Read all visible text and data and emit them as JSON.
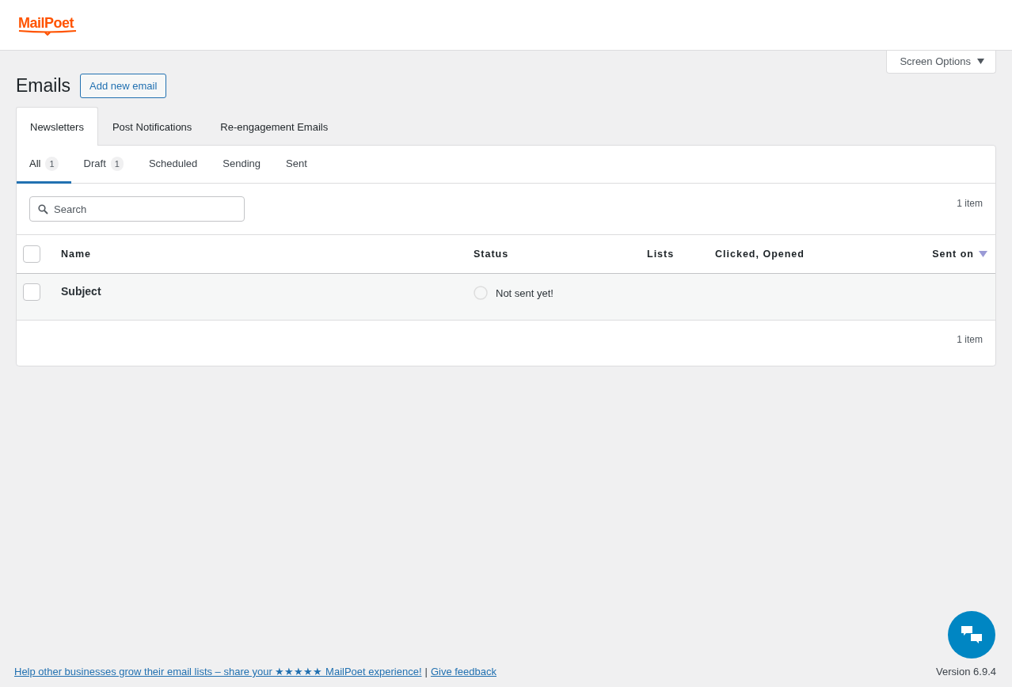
{
  "header": {
    "logo": "MailPoet"
  },
  "screen_options": {
    "label": "Screen Options",
    "expanded": false
  },
  "page": {
    "title": "Emails",
    "add_button": "Add new email"
  },
  "tabs": [
    {
      "label": "Newsletters",
      "selected": true
    },
    {
      "label": "Post Notifications",
      "selected": false
    },
    {
      "label": "Re-engagement Emails",
      "selected": false
    }
  ],
  "filters": [
    {
      "label": "All",
      "count": "1",
      "selected": true
    },
    {
      "label": "Draft",
      "count": "1",
      "selected": false
    },
    {
      "label": "Scheduled",
      "selected": false
    },
    {
      "label": "Sending",
      "selected": false
    },
    {
      "label": "Sent",
      "selected": false
    }
  ],
  "search": {
    "placeholder": "Search"
  },
  "item_count_top": "1 item",
  "table": {
    "columns": [
      {
        "label": "Name"
      },
      {
        "label": "Status"
      },
      {
        "label": "Lists"
      },
      {
        "label": "Clicked, Opened"
      },
      {
        "label": "Sent on",
        "sorted": true
      }
    ],
    "all_checked": false,
    "rows": [
      {
        "name": "Subject",
        "status": "Not sent yet!",
        "checked": false
      }
    ]
  },
  "item_count_bottom": "1 item",
  "footer": {
    "review_link": "Help other businesses grow their email lists – share your ★★★★★ MailPoet experience!",
    "separator": "|",
    "feedback_link": "Give feedback",
    "version": "Version 6.9.4"
  }
}
